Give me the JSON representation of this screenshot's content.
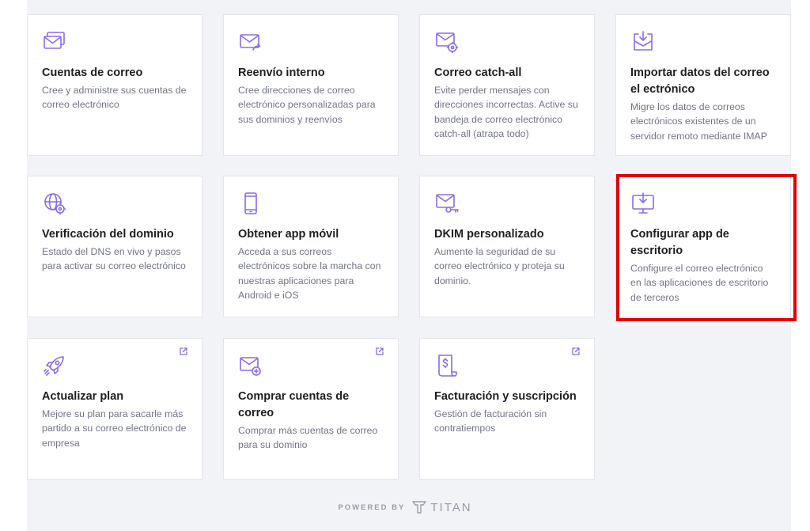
{
  "accent_color": "#8c6be8",
  "highlight_color": "#e00000",
  "cards": [
    {
      "icon": "mail-accounts-icon",
      "title": "Cuentas de correo",
      "desc": "Cree y administre sus cuentas de correo electrónico"
    },
    {
      "icon": "mail-forward-icon",
      "title": "Reenvío interno",
      "desc": "Cree direcciones de correo electrónico personalizadas para sus dominios y reenvíos"
    },
    {
      "icon": "mail-catchall-icon",
      "title": "Correo catch-all",
      "desc": "Evite perder mensajes con direcciones incorrectas. Active su bandeja de correo electrónico catch-all (atrapa todo)"
    },
    {
      "icon": "import-mail-icon",
      "title": "Importar datos del correo el ectrónico",
      "desc": "Migre los datos de correos electrónicos existentes de un servidor remoto mediante IMAP"
    },
    {
      "icon": "globe-gear-icon",
      "title": "Verificación del dominio",
      "desc": "Estado del DNS en vivo y pasos para activar su correo electrónico"
    },
    {
      "icon": "mobile-phone-icon",
      "title": "Obtener app móvil",
      "desc": "Acceda a sus correos electrónicos sobre la marcha con nuestras aplicaciones para Android e iOS"
    },
    {
      "icon": "mail-key-icon",
      "title": "DKIM personalizado",
      "desc": "Aumente la seguridad de su correo electrónico y proteja su dominio."
    },
    {
      "icon": "desktop-download-icon",
      "title": "Configurar app de escritorio",
      "desc": "Configure el correo electrónico en las aplicaciones de escritorio de terceros"
    },
    {
      "icon": "rocket-icon",
      "title": "Actualizar plan",
      "desc": "Mejore su plan para sacarle más partido a su correo electrónico de empresa",
      "external": true
    },
    {
      "icon": "mail-add-icon",
      "title": "Comprar cuentas de correo",
      "desc": "Comprar más cuentas de correo para su dominio",
      "external": true
    },
    {
      "icon": "receipt-icon",
      "title": "Facturación y suscripción",
      "desc": "Gestión de facturación sin contratiempos",
      "external": true
    }
  ],
  "footer": {
    "powered_by": "POWERED BY",
    "brand": "TITAN"
  }
}
